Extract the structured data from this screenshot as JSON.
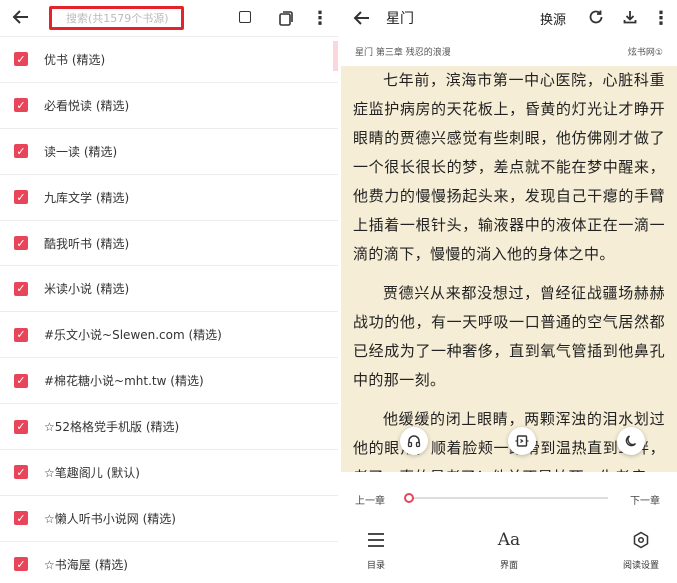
{
  "left": {
    "search_placeholder": "搜索(共1579个书源)",
    "sources": [
      {
        "label": "优书 (精选)"
      },
      {
        "label": "必看悦读 (精选)"
      },
      {
        "label": "读一读 (精选)"
      },
      {
        "label": "九库文学 (精选)"
      },
      {
        "label": "酷我听书 (精选)"
      },
      {
        "label": "米读小说 (精选)"
      },
      {
        "label": "#乐文小说~Slewen.com (精选)"
      },
      {
        "label": "#棉花糖小说~mht.tw (精选)"
      },
      {
        "label": "☆52格格党手机版 (精选)"
      },
      {
        "label": "☆笔趣阁儿 (默认)"
      },
      {
        "label": "☆懒人听书小说网 (精选)"
      },
      {
        "label": "☆书海屋 (精选)"
      }
    ],
    "check_mark": "✓"
  },
  "right": {
    "book_title": "星门",
    "swap_source": "换源",
    "chapter_info": "星门 第三章 残忍的浪漫",
    "source_info": "炫书网①",
    "paragraphs": [
      "七年前，滨海市第一中心医院，心脏科重症监护病房的天花板上，昏黄的灯光让才睁开眼睛的贾德兴感觉有些刺眼，他仿佛刚才做了一个很长很长的梦，差点就不能在梦中醒来，他费力的慢慢扬起头来，发现自己干瘪的手臂上插着一根针头，输液器中的液体正在一滴一滴的滴下，慢慢的淌入他的身体之中。",
      "贾德兴从来都没想过，曾经征战疆场赫赫战功的他，有一天呼吸一口普通的空气居然都已经成为了一种奢侈，直到氧气管插到他鼻孔中的那一刻。",
      "他缓缓的闭上眼睛，两颗浑浊的泪水划过他的眼角，顺着脸颊一路滑到温热直到耳畔，老了，真的是老了！他并不是怕死，生老病"
    ],
    "prev_chapter": "上一章",
    "next_chapter": "下一章",
    "progress": 0,
    "tabs": {
      "toc": "目录",
      "ui": "界面",
      "settings": "阅读设置",
      "ui_icon_text": "Aa"
    }
  },
  "colors": {
    "accent": "#e8455b",
    "highlight_border": "#e3242b",
    "reader_bg": "#f5edd6"
  }
}
